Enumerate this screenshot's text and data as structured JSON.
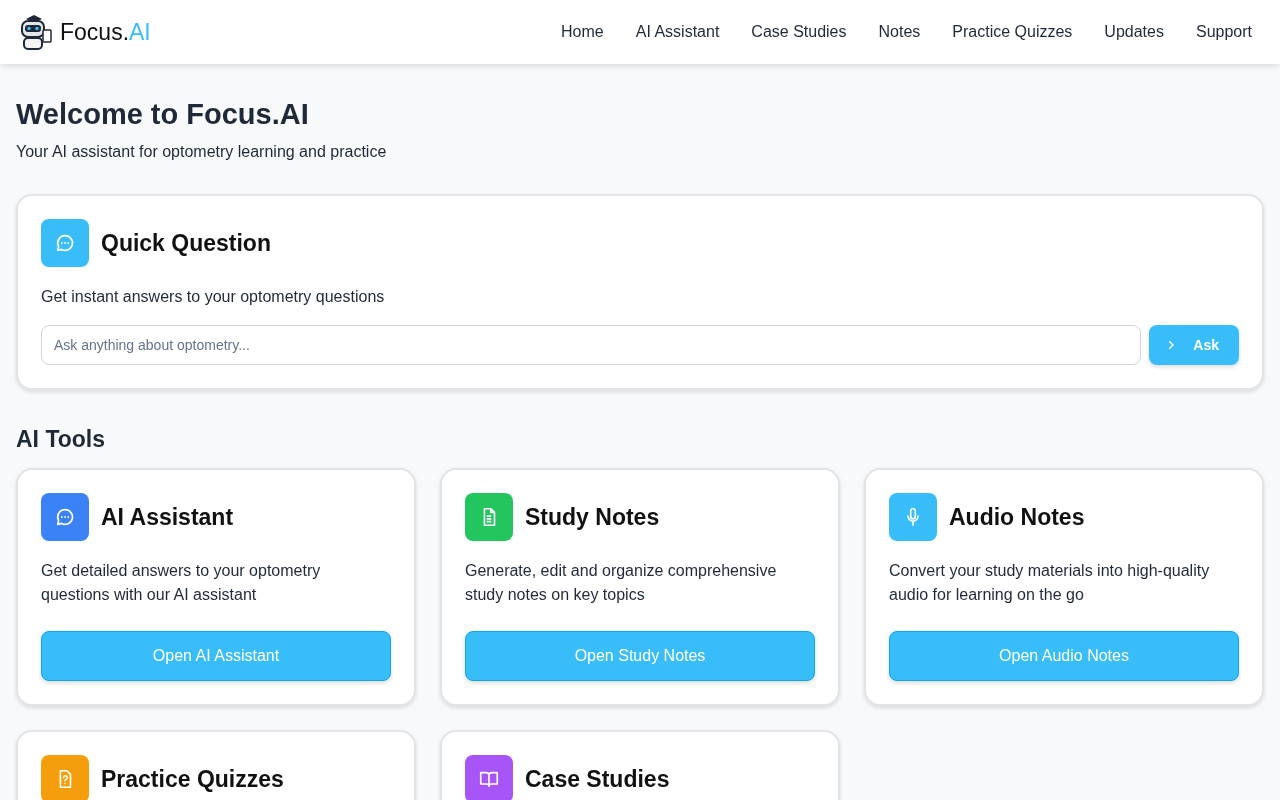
{
  "header": {
    "logo": {
      "text": "Focus.",
      "accent": "AI"
    },
    "nav": [
      {
        "label": "Home"
      },
      {
        "label": "AI Assistant"
      },
      {
        "label": "Case Studies"
      },
      {
        "label": "Notes"
      },
      {
        "label": "Practice Quizzes"
      },
      {
        "label": "Updates"
      },
      {
        "label": "Support"
      }
    ]
  },
  "welcome": {
    "title": "Welcome to Focus.AI",
    "subtitle": "Your AI assistant for optometry learning and practice"
  },
  "quick_question": {
    "title": "Quick Question",
    "description": "Get instant answers to your optometry questions",
    "input": {
      "placeholder": "Ask anything about optometry..."
    },
    "button": {
      "label": "Ask"
    }
  },
  "tools_section": {
    "title": "AI Tools"
  },
  "tools": [
    {
      "kind": "chat",
      "color": "#3b82f6",
      "title": "AI Assistant",
      "description": "Get detailed answers to your optometry questions with our AI assistant",
      "button": "Open AI Assistant"
    },
    {
      "kind": "document",
      "color": "#22c55e",
      "title": "Study Notes",
      "description": "Generate, edit and organize comprehensive study notes on key topics",
      "button": "Open Study Notes"
    },
    {
      "kind": "microphone",
      "color": "#38bdf8",
      "title": "Audio Notes",
      "description": "Convert your study materials into high-quality audio for learning on the go",
      "button": "Open Audio Notes"
    },
    {
      "kind": "quiz",
      "color": "#f59e0b",
      "title": "Practice Quizzes"
    },
    {
      "kind": "book",
      "color": "#a855f7",
      "title": "Case Studies"
    }
  ]
}
